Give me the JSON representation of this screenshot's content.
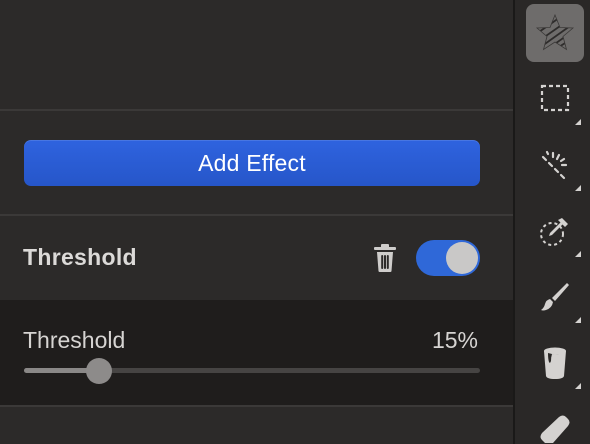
{
  "panel": {
    "add_effect_label": "Add Effect",
    "effect": {
      "title": "Threshold",
      "enabled": true,
      "setting": {
        "label": "Threshold",
        "value_text": "15%",
        "value_fraction": 0.165
      }
    }
  },
  "toolbar": {
    "tools": [
      {
        "icon": "magic-star-icon",
        "active": true
      },
      {
        "icon": "rectangle-selection-icon",
        "active": false
      },
      {
        "icon": "magic-wand-selection-icon",
        "active": false
      },
      {
        "icon": "color-picker-selection-icon",
        "active": false
      },
      {
        "icon": "brush-icon",
        "active": false
      },
      {
        "icon": "paint-bucket-icon",
        "active": false
      },
      {
        "icon": "eraser-icon",
        "active": false
      }
    ]
  },
  "colors": {
    "accent": "#2f63df",
    "toggle_on": "#2f68d8",
    "panel_bg": "#2c2a29",
    "settings_bg": "#1f1d1c"
  }
}
